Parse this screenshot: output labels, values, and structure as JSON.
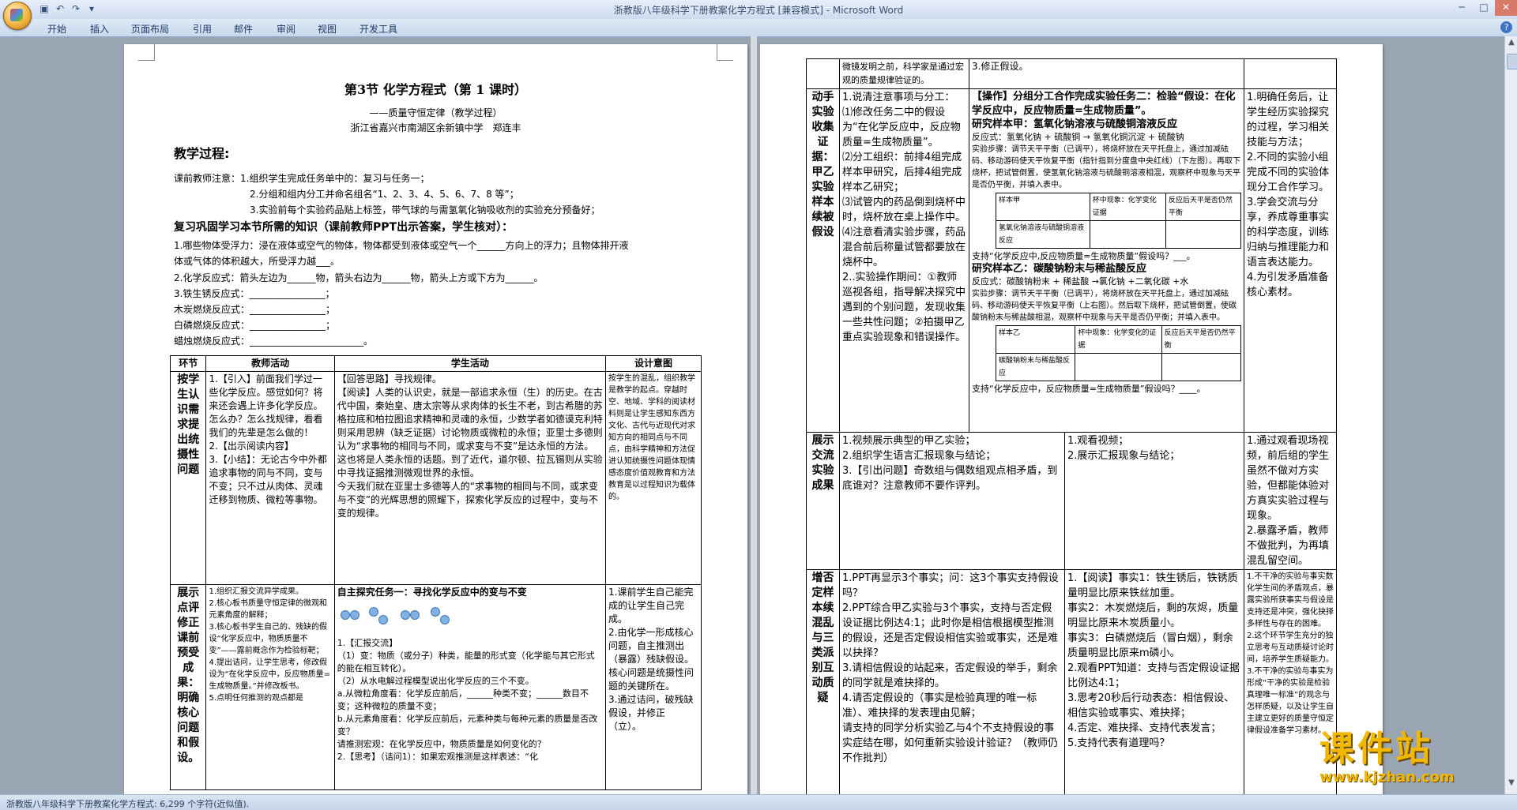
{
  "window": {
    "title": "浙教版八年级科学下册教案化学方程式 [兼容模式] - Microsoft Word"
  },
  "ribbon": {
    "tabs": [
      "开始",
      "插入",
      "页面布局",
      "引用",
      "邮件",
      "审阅",
      "视图",
      "开发工具"
    ]
  },
  "status": {
    "text": "浙教版八年级科学下册教案化学方程式: 6,299 个字符(近似值)."
  },
  "watermark": {
    "text": "课件站",
    "url": "www.kjzhan.com"
  },
  "left": {
    "title": "第3节 化学方程式（第 1 课时）",
    "subtitle": "——质量守恒定律（教学过程）",
    "author": "浙江省嘉兴市南湖区余新镇中学　郑连丰",
    "process_heading": "教学过程:",
    "notes": [
      "课前教师注意：1.组织学生完成任务单中的：复习与任务一；",
      "2.分组和组内分工并命名组名“1、2、3、4、5、6、7、8 等”；",
      "3.实验前每个实验药品贴上标签，带气球的与需氢氧化钠吸收剂的实验充分预备好；"
    ],
    "review_heading": "复习巩固学习本节所需的知识（课前教师PPT出示答案，学生核对）：",
    "review_lines": [
      "1.哪些物体受浮力：浸在液体或空气的物体，物体都受到液体或空气一个______方向上的浮力；且物体排开液",
      "体或气体的体积越大，所受浮力越___。",
      "2.化学反应式：箭头左边为______物，箭头右边为______物，箭头上方或下方为______。",
      "3.铁生锈反应式：________________；",
      "木炭燃烧反应式：________________；",
      "白磷燃烧反应式：________________；",
      "蜡烛燃烧反应式：________________________。"
    ],
    "table": {
      "headers": [
        "环节",
        "教师活动",
        "学生活动",
        "设计意图"
      ],
      "row1": {
        "phase": "按学生认识需求提出统摄性问题",
        "teacher": "1.【引入】前面我们学过一些化学反应。感觉如何？将来还会遇上许多化学反应。怎么办？怎么找规律，看看我们的先辈是怎么做的！\n2.【出示阅读内容】\n3.【小结】：无论古今中外都追求事物的同与不同，变与不变；只不过从肉体、灵魂迁移到物质、微粒等事物。",
        "student": "【回答思路】寻找规律。\n【阅读】人类的认识史，就是一部追求永恒（生）的历史。在古代中国，秦始皇、唐太宗等从求肉体的长生不老，到古希腊的苏格拉底和柏拉图追求精神和灵魂的永恒，少数学者如德谟克利特则采用思辨（缺乏证据）讨论物质或微粒的永恒；亚里士多德则认为“求事物的相同与不同，或求变与不变”是达永恒的方法。这也将是人类永恒的话题。到了近代，道尔顿、拉瓦锡则从实验中寻找证据推测微观世界的永恒。\n今天我们就在亚里士多德等人的“求事物的相同与不同，或求变与不变”的光辉思想的照耀下，探索化学反应的过程中，变与不变的规律。",
        "intent": "按学生的混乱，组织教学是教学的起点。穿越时空、地域、学科的阅读材料则是让学生感知东西方文化、古代与近现代对求知方向的相同点与不同点，由科学精神和方法促进认知统摄性问题体现情感态度价值观教育和方法教育是以过程知识为载体的。"
      },
      "row2": {
        "phase": "展示点评修正课前预受成果：明确核心问题和假设。",
        "teacher": "1.组织汇报交流异学成果。\n2.核心板书质量守恒定律的微观和元素角度的解释；\n3.核心板书学生自己的、残缺的假设“化学反应中，物质质量不变”——露前概念作为检验标靶；\n4.提出诘问，让学生思考，修改假设为“在化学反应中，反应物质量=生成物质量。”并修改板书。\n5.点明任何推测的观点都是",
        "student_task": "自主探究任务一：寻找化学反应中的变与不变",
        "student": "1.【汇报交流】\n（1）变：物质（或分子）种类，能量的形式变（化学能与其它形式的能在相互转化）。\n（2）从水电解过程模型说出化学反应的三个不变。\na.从微粒角度看：化学反应前后，______种类不变；______数目不变；这种微粒的质量不变；\nb.从元素角度看：化学反应前后，元素种类与每种元素的质量是否改变？\n请推测宏观：在化学反应中，物质质量是如何变化的？\n2.【思考】（诘问1）：如果宏观推测是这样表述：“化",
        "intent": "1.课前学生自己能完成的让学生自己完成。\n2.由化学一形成核心问题，自主推测出（暴露）残缺假设。核心问题是统摄性问题的关键所在。\n3.通过诘问，破残缺假设，并修正（立）。"
      }
    }
  },
  "right": {
    "top_row": {
      "left": "微镜发明之前，科学家是通过宏观的质量规律验证的。",
      "mid": "3.修正假设。"
    },
    "table": {
      "row1": {
        "phase": "动手实验收集证据：甲乙实验样本续被假设",
        "teacher": "1.说清注意事项与分工：\n⑴修改任务二中的假设为“在化学反应中，反应物质量=生成物质量”。\n⑵分工组织：前排4组完成样本甲研究，后排4组完成样本乙研究；\n⑶试管内的药品倒到烧杯中时，烧杯放在桌上操作中。\n⑷注意看清实验步骤，药品混合前后称量试管都要放在烧杯中。\n2..实验操作期间：①教师巡视各组，指导解决探究中遇到的个别问题，发现收集一些共性问题；②拍摄甲乙重点实验现象和错误操作。",
        "op_title": "【操作】分组分工合作完成实验任务二：检验“假设：在化学反应中，反应物质量=生成物质量”。",
        "sample_a_title": "研究样本甲：氢氧化钠溶液与硫酸铜溶液反应",
        "sample_a_eq": "反应式：氢氧化钠 + 硫酸铜 → 氢氧化铜沉淀 + 硫酸钠",
        "sample_a_steps": "实验步骤：调节天平平衡（已调平），将烧杯放在天平托盘上，通过加减砝码、移动游码使天平恢复平衡（指针指到分度盘中央红线）（下左图）。再取下烧杯，把试管倒置，使氢氧化钠溶液与硫酸铜溶液相混，观察杯中现象与天平是否仍平衡，并填入表中。",
        "mini_a": [
          "样本甲",
          "杯中现象：化学变化证据",
          "反应后天平是否仍然平衡",
          "氢氧化钠溶液与硫酸铜溶液反应"
        ],
        "support_a": "支持“化学反应中,反应物质量=生成物质量”假设吗？___。",
        "sample_b_title": "研究样本乙：碳酸钠粉末与稀盐酸反应",
        "sample_b_eq": "反应式：碳酸钠粉末 + 稀盐酸 →氯化钠 +二氧化碳 +水",
        "sample_b_steps": "实验步骤：调节天平平衡（已调平），将烧杯放在天平托盘上，通过加减砝码、移动游码使天平恢复平衡（上右图）。然后取下烧杯，把试管倒置，使碳酸钠粉末与稀盐酸相混，观察杯中现象与天平是否仍平衡；并填入表中。",
        "mini_b": [
          "样本乙",
          "杯中现象：化学变化的证据",
          "反应后天平是否仍然平衡",
          "碳酸钠粉末与稀盐酸反应"
        ],
        "support_b": "支持“化学反应中，反应物质量=生成物质量”假设吗？____。",
        "intent": "1.明确任务后，让学生经历实验探究的过程，学习相关技能与方法；\n2.不同的实验小组完成不同的实验体现分工合作学习。\n3.学会交流与分享，养成尊重事实的科学态度，训练归纳与推理能力和语言表达能力。\n4.为引发矛盾准备核心素材。"
      },
      "row2": {
        "phase": "展示交流实验成果",
        "teacher": "1.视频展示典型的甲乙实验；\n2.组织学生语言汇报现象与结论；\n3.【引出问题】奇数组与偶数组观点相矛盾，到底谁对？注意教师不要作评判。",
        "student": "1.观看视频；\n2.展示汇报现象与结论；",
        "intent": "1.通过观看现场视频，前后组的学生虽然不做对方实验，但都能体验对方真实实验过程与现象。\n2.暴露矛盾，教师不做批判，为再填混乱留空间。"
      },
      "row3": {
        "phase": "增否定样本续混乱与三类派别互动质疑",
        "teacher": "1.PPT再显示3个事实；问：这3个事实支持假设吗？\n2.PPT综合甲乙实验与3个事实，支持与否定假设证据比例达4:1；此时你是相信根据模型推测的假设，还是否定假设相信实验或事实，还是难以抉择？\n3.请相信假设的站起来，否定假设的举手，剩余的同学就是难抉择的。\n4.请否定假设的（事实是检验真理的唯一标准）、难抉择的发表理由见解；\n请支持的同学分析实验乙与4个不支持假设的事实症结在哪，如何重新实验设计验证？（教师仍不作批判）",
        "student": "1.【阅读】事实1：铁生锈后，铁锈质量明显比原来铁丝加重。\n事实2：木炭燃烧后，剩的灰烬，质量明显比原来木炭质量小。\n事实3：白磷燃烧后（冒白烟），剩余质量明显比原来m磷小。\n2.观看PPT知道：支持与否定假设证据比例达4:1；\n3.思考20秒后行动表态：相信假设、相信实验或事实、难抉择；\n4.否定、难抉择、支持代表发言；\n5.支持代表有道理吗？",
        "intent": "1.不干净的实验与事实数化学生间的矛盾观点，暴露实验所获事实与假设是支持还是冲突，强化抉择多样性与存在的困难。\n2.这个环节学生充分的独立思考与互动质疑讨论时间，培养学生质疑能力。\n3.不干净的实验与事实为形成“干净的实验是检验真理唯一标准”的观念与怎样质疑，以及让学生自主建立更好的质量守恒定律假设准备学习素材。"
      }
    }
  }
}
